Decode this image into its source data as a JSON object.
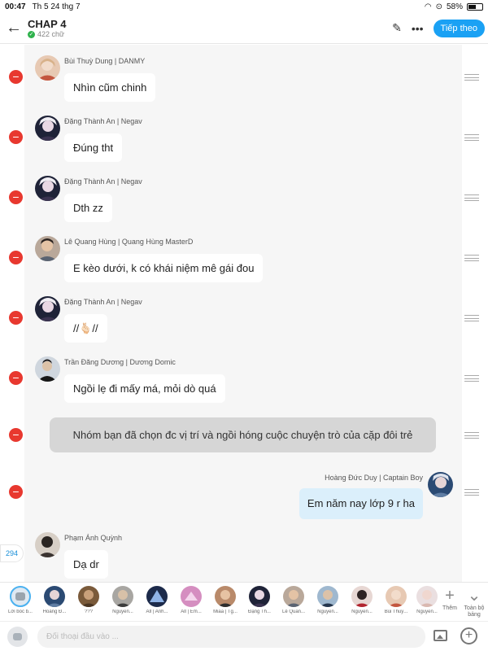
{
  "status_bar": {
    "time": "00:47",
    "date": "Th 5 24 thg 7",
    "battery": "58%"
  },
  "header": {
    "title": "CHAP 4",
    "word_count": "422 chữ",
    "continue_label": "Tiếp theo"
  },
  "messages": [
    {
      "sender": "Bùi Thuỳ Dung | DANMY",
      "text": "Nhìn cũm chinh"
    },
    {
      "sender": "Đặng Thành An | Negav",
      "text": "Đúng tht"
    },
    {
      "sender": "Đặng Thành An | Negav",
      "text": "Dth zz"
    },
    {
      "sender": "Lê Quang Hùng | Quang Hùng MasterD",
      "text": "E kèo dưới, k có khái niệm mê gái đou"
    },
    {
      "sender": "Đặng Thành An | Negav",
      "text": "//🫰🏻//"
    },
    {
      "sender": "Trần Đăng Dương | Dương Domic",
      "text": "Ngồi lẹ đi mấy má, mỏi dò quá"
    }
  ],
  "narration": "Nhóm bạn đã chọn đc vị trí và ngồi hóng cuộc chuyện trò của cặp đôi trẻ",
  "right_message": {
    "sender": "Hoàng Đức Duy | Captain Boy",
    "text": "Em năm nay lớp 9 r ha"
  },
  "last_message": {
    "sender": "Phạm Ánh Quỳnh",
    "text": "Dạ dr"
  },
  "message_count": "294",
  "characters": [
    {
      "name": "Lời bốc b..."
    },
    {
      "name": "Hoàng Đ..."
    },
    {
      "name": "???"
    },
    {
      "name": "Nguyễn..."
    },
    {
      "name": "All | Anh..."
    },
    {
      "name": "All | Em..."
    },
    {
      "name": "Miaa | Tg..."
    },
    {
      "name": "Đặng Th..."
    },
    {
      "name": "Lê Quan..."
    },
    {
      "name": "Nguyễn..."
    },
    {
      "name": "Nguyễn..."
    },
    {
      "name": "Bùi Thuỳ..."
    },
    {
      "name": "Nguyễn..."
    }
  ],
  "add_label": "Thêm",
  "all_label": "Toàn bộ bảng",
  "input": {
    "placeholder": "Đối thoại đầu vào ..."
  },
  "colors": {
    "accent": "#1aa1f4",
    "delete": "#e8382f",
    "narration_bg": "#d6d6d6",
    "right_bubble": "#dbeffb"
  }
}
